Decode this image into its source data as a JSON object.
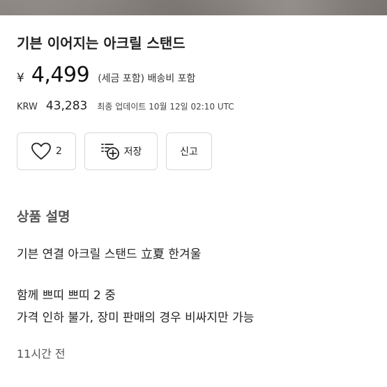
{
  "product": {
    "title": "기븐 이어지는 아크릴 스탠드",
    "currency_symbol": "¥",
    "price": "4,499",
    "tax_note": "(세금 포함) 배송비 포함",
    "krw_label": "KRW",
    "krw_value": "43,283",
    "updated": "최종 업데이트 10월 12일 02:10 UTC"
  },
  "actions": {
    "like_count": "2",
    "save_label": "저장",
    "report_label": "신고"
  },
  "description": {
    "section_title": "상품 설명",
    "lines": [
      "기븐 연결 아크릴 스탠드 立夏 한겨울",
      "함께 쁘띠 쁘띠 2 중",
      "가격 인하 불가, 장미 판매의 경우 비싸지만 가능"
    ],
    "time_ago": "11시간 전"
  },
  "icons": {
    "like": "heart-icon",
    "save": "add-to-list-icon"
  }
}
